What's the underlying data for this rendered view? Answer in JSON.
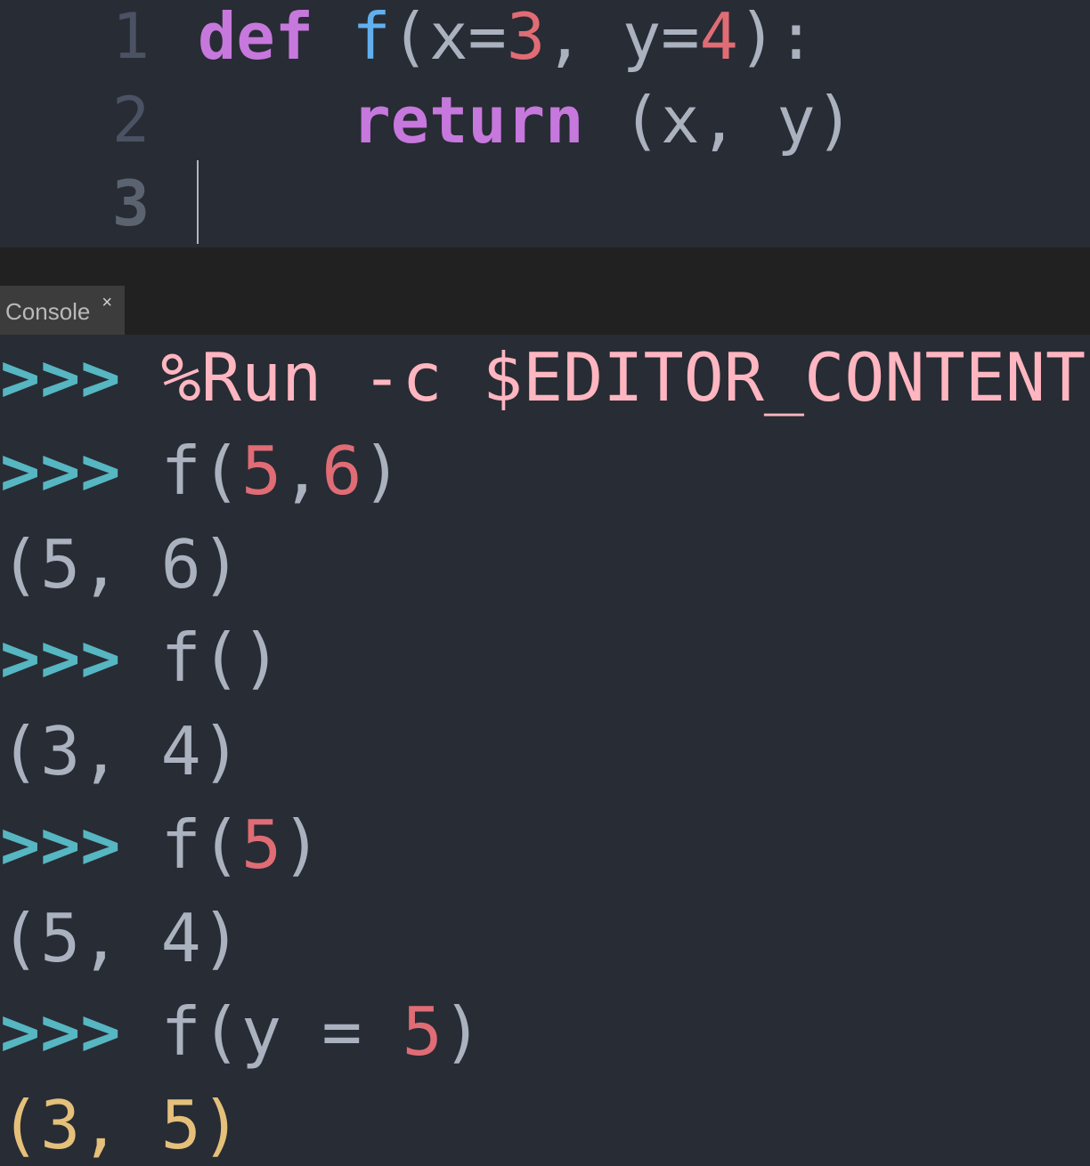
{
  "editor": {
    "lines": [
      {
        "num": "1",
        "tokens": [
          {
            "t": "def",
            "c": "kw"
          },
          {
            "t": " ",
            "c": "punc"
          },
          {
            "t": "f",
            "c": "fn"
          },
          {
            "t": "(x=",
            "c": "punc"
          },
          {
            "t": "3",
            "c": "num"
          },
          {
            "t": ", y=",
            "c": "punc"
          },
          {
            "t": "4",
            "c": "num"
          },
          {
            "t": "):",
            "c": "punc"
          }
        ]
      },
      {
        "num": "2",
        "tokens": [
          {
            "t": "    ",
            "c": "punc"
          },
          {
            "t": "return",
            "c": "kw"
          },
          {
            "t": " (x, y)",
            "c": "punc"
          }
        ]
      },
      {
        "num": "3",
        "tokens": []
      }
    ]
  },
  "console_tab": {
    "label": "Console",
    "close_glyph": "×"
  },
  "console": {
    "prompt": ">>>",
    "entries": [
      {
        "kind": "input",
        "tokens": [
          {
            "t": "%Run -c $EDITOR_CONTENT",
            "c": "magic"
          }
        ]
      },
      {
        "kind": "input",
        "tokens": [
          {
            "t": "f(",
            "c": "punc"
          },
          {
            "t": "5",
            "c": "num"
          },
          {
            "t": ",",
            "c": "punc"
          },
          {
            "t": "6",
            "c": "num"
          },
          {
            "t": ")",
            "c": "punc"
          }
        ]
      },
      {
        "kind": "output",
        "text": "(5, 6)",
        "c": "out"
      },
      {
        "kind": "input",
        "tokens": [
          {
            "t": "f()",
            "c": "punc"
          }
        ]
      },
      {
        "kind": "output",
        "text": "(3, 4)",
        "c": "out"
      },
      {
        "kind": "input",
        "tokens": [
          {
            "t": "f(",
            "c": "punc"
          },
          {
            "t": "5",
            "c": "num"
          },
          {
            "t": ")",
            "c": "punc"
          }
        ]
      },
      {
        "kind": "output",
        "text": "(5, 4)",
        "c": "out"
      },
      {
        "kind": "input",
        "tokens": [
          {
            "t": "f(y = ",
            "c": "punc"
          },
          {
            "t": "5",
            "c": "num"
          },
          {
            "t": ")",
            "c": "punc"
          }
        ]
      },
      {
        "kind": "output",
        "text": "(3, 5)",
        "c": "out-hl"
      }
    ]
  },
  "colors": {
    "background": "#282c34",
    "keyword": "#c678dd",
    "function": "#61afef",
    "number": "#e06c75",
    "prompt": "#56b6c2",
    "magic": "#ffb6c1",
    "highlight_output": "#e5c07b"
  }
}
